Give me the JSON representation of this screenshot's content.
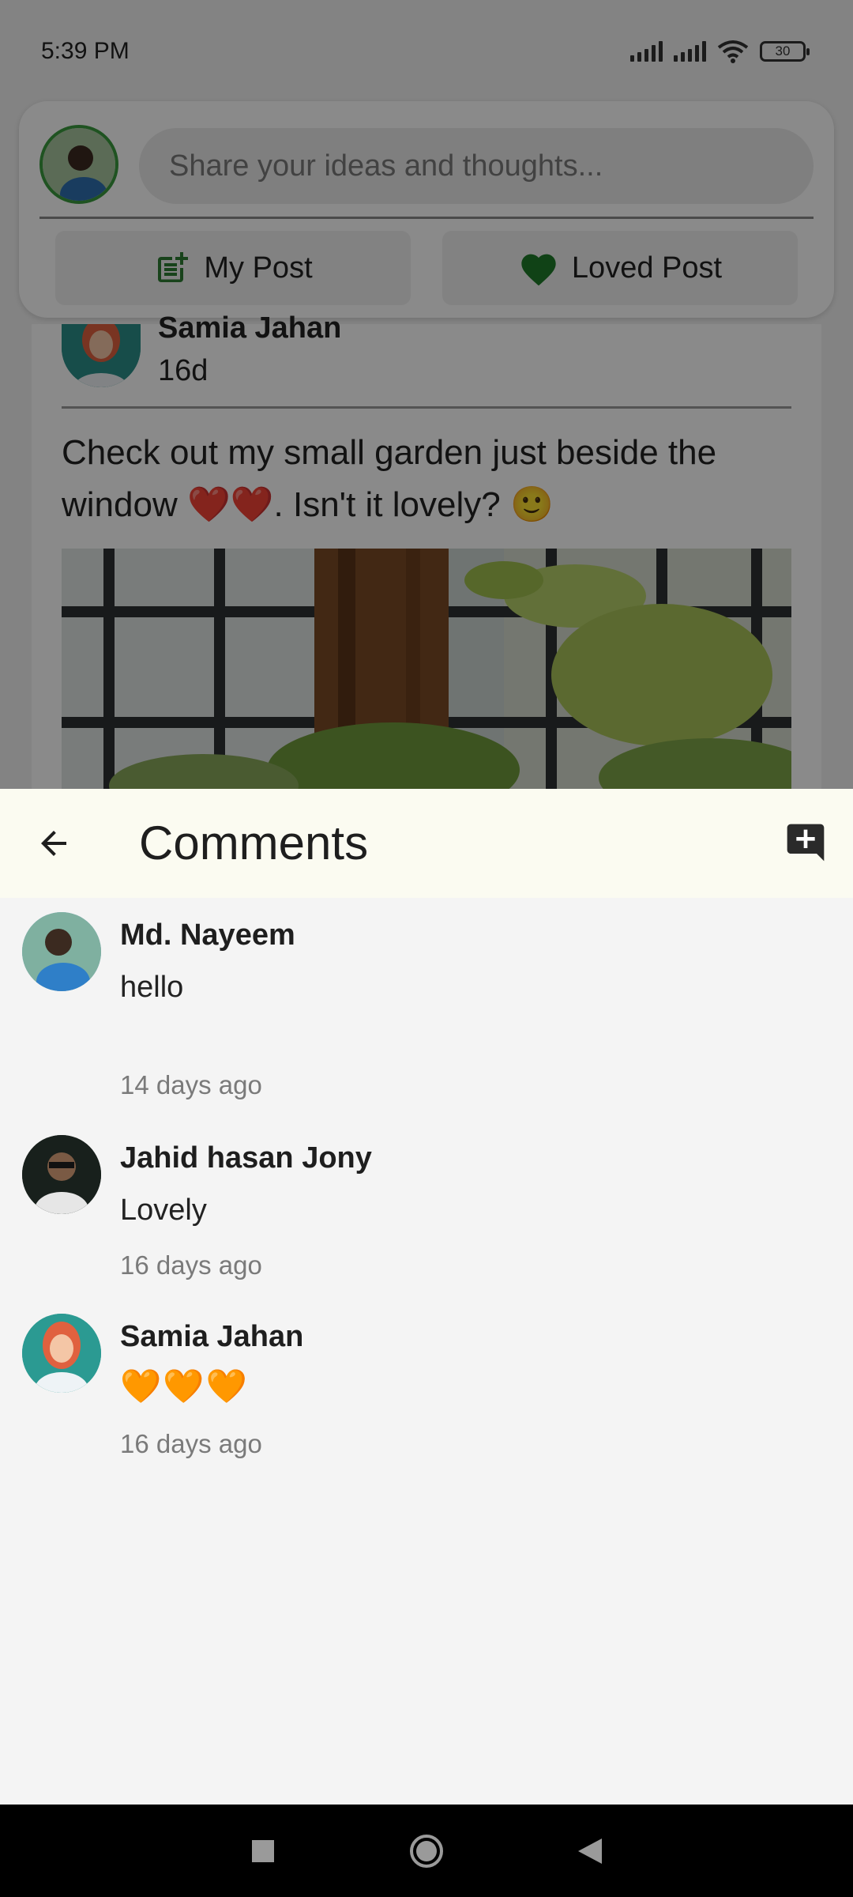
{
  "status_bar": {
    "time": "5:39 PM",
    "battery": "30"
  },
  "composer": {
    "placeholder": "Share your ideas and thoughts...",
    "my_post_label": "My Post",
    "loved_post_label": "Loved Post"
  },
  "post": {
    "author": "Samia Jahan",
    "time": "16d",
    "text": "Check out my small garden just beside the window ❤️❤️. Isn't it lovely? 🙂"
  },
  "comments_panel": {
    "title": "Comments",
    "comments": [
      {
        "author": "Md. Nayeem",
        "text": "hello",
        "time": "14 days ago"
      },
      {
        "author": "Jahid hasan Jony",
        "text": "Lovely",
        "time": "16 days ago"
      },
      {
        "author": "Samia Jahan",
        "text": "🧡🧡🧡",
        "time": "16 days ago"
      }
    ]
  },
  "colors": {
    "accent_green": "#2e7d32",
    "header_bg": "#fbfbf1",
    "sheet_bg": "#f4f4f4",
    "secondary_text": "#7a7a7a"
  },
  "icons": {
    "back": "arrow-left-icon",
    "add_comment": "add-comment-icon",
    "my_post": "post-add-icon",
    "loved_post": "heart-icon"
  }
}
